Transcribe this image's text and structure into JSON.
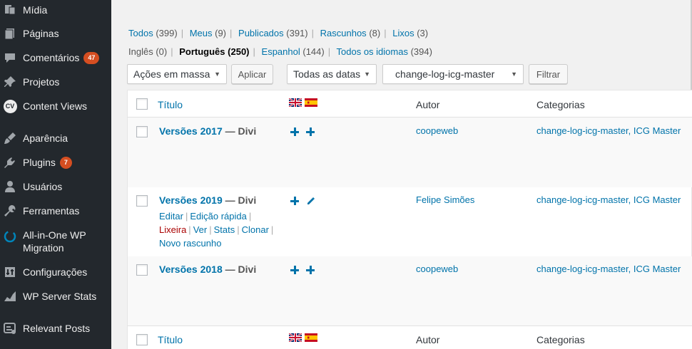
{
  "sidebar": {
    "items": [
      {
        "label": "Mídia",
        "icon": "media-icon"
      },
      {
        "label": "Páginas",
        "icon": "pages-icon"
      },
      {
        "label": "Comentários",
        "icon": "comments-icon",
        "badge": "47"
      },
      {
        "label": "Projetos",
        "icon": "pin-icon"
      },
      {
        "label": "Content Views",
        "icon": "cv-icon",
        "icon_text": "CV"
      },
      {
        "label": "Aparência",
        "icon": "appearance-icon"
      },
      {
        "label": "Plugins",
        "icon": "plugins-icon",
        "badge": "7"
      },
      {
        "label": "Usuários",
        "icon": "users-icon"
      },
      {
        "label": "Ferramentas",
        "icon": "tools-icon"
      },
      {
        "label": "All-in-One WP",
        "label2": "Migration",
        "icon": "migration-icon"
      },
      {
        "label": "Configurações",
        "icon": "settings-icon"
      },
      {
        "label": "WP Server Stats",
        "icon": "stats-icon"
      },
      {
        "label": "Relevant Posts",
        "icon": "relevant-posts-icon"
      }
    ]
  },
  "status_filters": [
    {
      "label": "Todos",
      "count": "(399)"
    },
    {
      "label": "Meus",
      "count": "(9)"
    },
    {
      "label": "Publicados",
      "count": "(391)"
    },
    {
      "label": "Rascunhos",
      "count": "(8)"
    },
    {
      "label": "Lixos",
      "count": "(3)"
    }
  ],
  "language_filters": [
    {
      "label": "Inglês",
      "count": "(0)",
      "state": "plain"
    },
    {
      "label": "Português",
      "count": "(250)",
      "state": "current"
    },
    {
      "label": "Espanhol",
      "count": "(144)",
      "state": "link"
    },
    {
      "label": "Todos os idiomas",
      "count": "(394)",
      "state": "link"
    }
  ],
  "toolbar": {
    "bulk_action": "Ações em massa",
    "apply": "Aplicar",
    "date_filter": "Todas as datas",
    "category_filter": "change-log-icg-master",
    "filter": "Filtrar"
  },
  "table": {
    "columns": {
      "title": "Título",
      "author": "Autor",
      "categories": "Categorias"
    },
    "rows": [
      {
        "title": "Versões 2017",
        "suffix": "— Divi",
        "author": "coopeweb",
        "cat1": "change-log-icg-master",
        "cat2": "ICG Master",
        "en_action": "add",
        "es_action": "add"
      },
      {
        "title": "Versões 2019",
        "suffix": "— Divi",
        "author": "Felipe Simões",
        "cat1": "change-log-icg-master",
        "cat2": "ICG Master",
        "en_action": "add",
        "es_action": "edit",
        "actions": {
          "edit": "Editar",
          "quick_edit": "Edição rápida",
          "trash": "Lixeira",
          "view": "Ver",
          "stats": "Stats",
          "clone": "Clonar",
          "new_draft": "Novo rascunho"
        }
      },
      {
        "title": "Versões 2018",
        "suffix": "— Divi",
        "author": "coopeweb",
        "cat1": "change-log-icg-master",
        "cat2": "ICG Master",
        "en_action": "add",
        "es_action": "add"
      }
    ]
  },
  "colors": {
    "sidebar_bg": "#23282d",
    "link": "#0073aa",
    "badge": "#d54e21",
    "trash": "#a00"
  }
}
